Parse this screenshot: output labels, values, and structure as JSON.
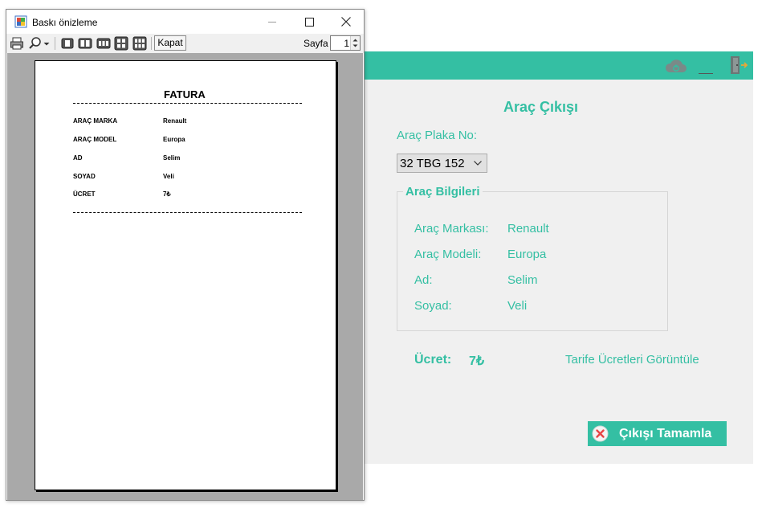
{
  "app": {
    "title": "Araç Çıkışı",
    "plate_label": "Araç Plaka No:",
    "plate_selected": "32 TBG 152",
    "group_title": "Araç Bilgileri",
    "fields": [
      {
        "label": "Araç Markası:",
        "value": "Renault"
      },
      {
        "label": "Araç Modeli:",
        "value": "Europa"
      },
      {
        "label": "Ad:",
        "value": "Selim"
      },
      {
        "label": "Soyad:",
        "value": "Veli"
      }
    ],
    "fee_label": "Ücret:",
    "fee_value": "7₺",
    "tariff_link": "Tarife Ücretleri Görüntüle",
    "complete_button": "Çıkışı Tamamla",
    "minimize_label": "__",
    "accent_color": "#34bfa3"
  },
  "preview": {
    "window_title": "Baskı önizleme",
    "close_button": "Kapat",
    "page_label": "Sayfa",
    "page_number": "1",
    "invoice": {
      "title": "FATURA",
      "rows": [
        {
          "label": "ARAÇ MARKA",
          "value": "Renault"
        },
        {
          "label": "ARAÇ MODEL",
          "value": "Europa"
        },
        {
          "label": "AD",
          "value": "Selim"
        },
        {
          "label": "SOYAD",
          "value": "Veli"
        },
        {
          "label": "ÜCRET",
          "value": "7₺"
        }
      ]
    }
  }
}
